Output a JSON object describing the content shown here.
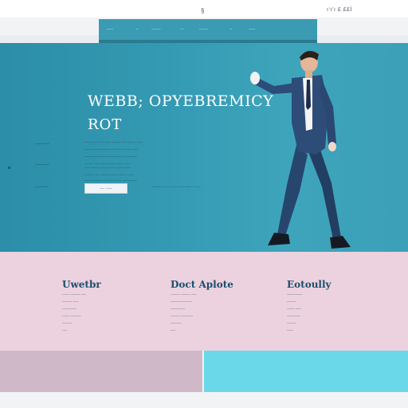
{
  "header": {
    "logo": "§",
    "right_text": "ı‘ı’ı £ ££İ"
  },
  "nav": {
    "items": [
      "‐‐‐‐‐",
      "‐‐",
      "‐‐‐‐‐‐‐",
      "‐‐‐",
      "‐‐‐‐‐‐‐",
      "‐‐",
      "‐‐‐‐‐"
    ]
  },
  "hero": {
    "title": "WEBB; OPYEBREMICY",
    "subtitle": "ROT",
    "side_labels": [
      "‐‐‐‐‐‐‐‐‐‐‐",
      "‐‐‐‐‐‐‐‐‐‐‐",
      "‐‐‐‐‐‐‐‐‐‐"
    ],
    "lines": [
      "‐‐‐‐ ‐‐‐‐‐ ‐‐‐‐‐‐ ‐‐‐‐ ‐‐‐‐‐‐‐ ‐‐‐‐‐ ‐‐‐‐‐‐ ‐‐‐‐‐‐",
      "‐‐‐‐‐‐ ‐‐‐‐ ‐‐‐‐‐‐‐‐ ‐‐‐‐ ‐‐‐‐‐‐ ‐‐‐‐‐‐‐ ‐‐‐‐‐",
      "‐‐‐‐ ‐‐‐‐‐‐ ‐‐‐‐‐‐‐ ‐‐‐‐‐ ‐‐‐‐‐‐ ‐‐‐‐ ‐‐‐‐‐‐‐",
      "‐‐‐‐‐‐‐ ‐‐‐‐ ‐‐‐‐‐‐ ‐‐‐‐‐‐‐ ‐‐‐‐ ‐‐‐‐‐‐",
      "‐‐‐‐‐ ‐‐‐‐‐‐‐ ‐‐‐‐ ‐‐‐‐‐‐‐ ‐‐‐‐‐‐ ‐‐‐‐‐",
      "‐‐‐‐‐‐‐‐ ‐‐‐‐ ‐‐‐‐‐‐ ‐‐‐‐‐‐‐‐ ‐‐‐‐‐‐ ‐‐‐‐‐",
      "‐‐‐‐‐‐ ‐‐‐‐‐‐ ‐‐‐‐‐ ‐‐‐‐‐‐‐ ‐‐‐‐ ‐‐‐‐‐‐ ‐‐‐‐‐",
      "‐‐‐‐‐‐‐‐ ‐‐‐‐‐‐ ‐‐‐‐‐‐‐ ‐‐‐‐ ‐‐‐‐‐‐‐ ‐‐‐‐‐"
    ],
    "button_label": "‐‐‐ ‐‐‐‐"
  },
  "features": [
    {
      "title": "Uwetbr",
      "lines": [
        "‐‐‐‐‐‐ ‐‐‐‐‐‐‐‐ ‐‐‐‐",
        "‐‐‐‐‐‐‐‐ ‐‐‐‐‐",
        "‐‐‐‐‐‐‐‐‐‐‐‐",
        "‐‐‐‐‐‐ ‐‐‐‐‐‐‐‐‐",
        "‐‐‐‐‐‐‐‐",
        "‐‐‐‐"
      ]
    },
    {
      "title": "Doct Aplote",
      "lines": [
        "‐‐‐‐‐‐‐‐ ‐‐‐‐‐‐‐‐ ‐‐‐‐",
        "‐‐‐‐‐‐‐‐‐‐‐‐‐‐‐‐‐‐",
        "‐‐‐‐‐‐‐‐‐‐‐‐",
        "‐‐‐‐‐‐‐ ‐‐‐‐‐‐‐‐‐‐‐",
        "‐‐‐‐‐‐‐‐‐",
        "‐‐‐‐"
      ]
    },
    {
      "title": "Eotoully",
      "lines": [
        "‐‐‐‐‐‐‐‐‐‐‐‐‐",
        "‐‐‐‐‐‐‐‐",
        "‐‐‐‐‐‐ ‐‐‐‐‐",
        "‐‐‐‐‐‐‐‐‐‐‐",
        "‐‐‐‐‐‐‐‐",
        "‐‐‐‐‐"
      ]
    }
  ],
  "colors": {
    "hero_teal": "#3499b2",
    "nav_teal": "#3a9bb3",
    "feature_pink": "#ecd2df",
    "bottom_pink": "#cfb8c8",
    "bottom_cyan": "#6ad8e8",
    "feature_title": "#1b4e6e"
  }
}
